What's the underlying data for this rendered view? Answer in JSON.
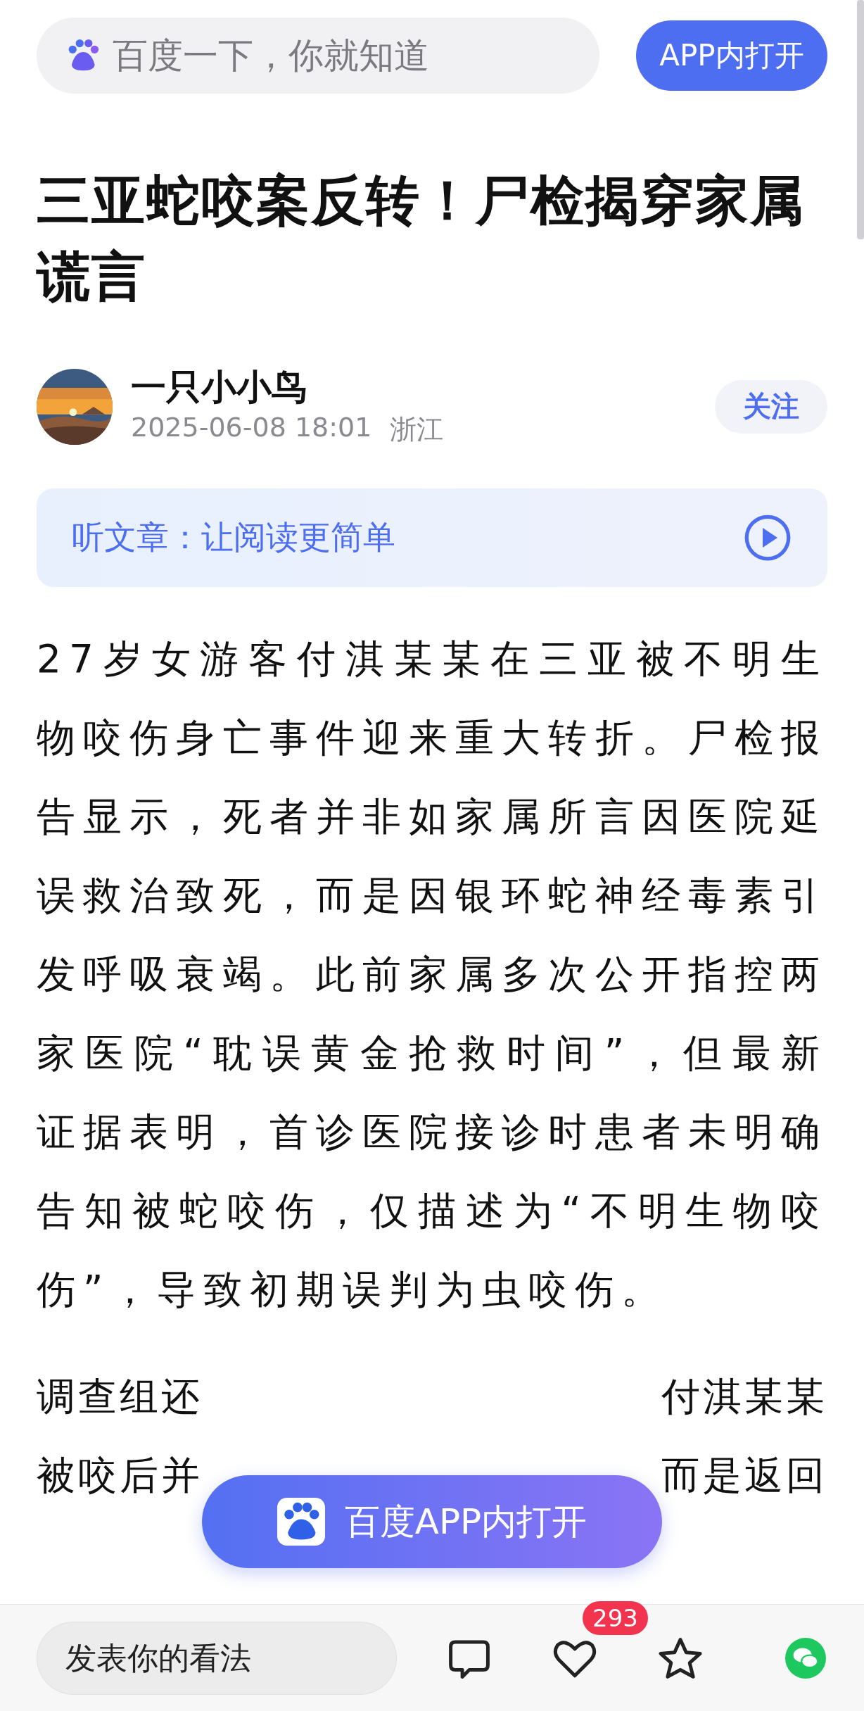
{
  "top_bar": {
    "search": {
      "placeholder": "百度一下，你就知道"
    },
    "open_button": "APP内打开"
  },
  "article": {
    "title": "三亚蛇咬案反转！尸检揭穿家属谎言",
    "author": {
      "name": "一只小小鸟",
      "date": "2025-06-08 18:01",
      "location": "浙江",
      "follow": "关注"
    },
    "listen": {
      "label": "听文章：让阅读更简单"
    },
    "paragraphs": [
      "27岁女游客付淇某某在三亚被不明生物咬伤身亡事件迎来重大转折。尸检报告显示，死者并非如家属所言因医院延误救治致死，而是因银环蛇神经毒素引发呼吸衰竭。此前家属多次公开指控两家医院“耽误黄金抢救时间”，但最新证据表明，首诊医院接诊时患者未明确告知被蛇咬伤，仅描述为“不明生物咬伤”，导致初期误判为虫咬伤。"
    ],
    "covered_lines": [
      [
        "调查组还",
        "付淇某某"
      ],
      [
        "被咬后并",
        "而是返回"
      ]
    ]
  },
  "floating_button": "百度APP内打开",
  "bottom_bar": {
    "comment": {
      "placeholder": "发表你的看法"
    },
    "like_count": "293"
  }
}
